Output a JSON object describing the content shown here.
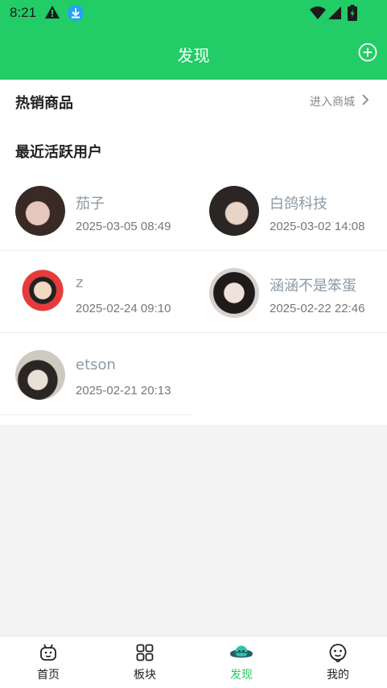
{
  "status_bar": {
    "time": "8:21"
  },
  "app_bar": {
    "title": "发现"
  },
  "shop": {
    "label": "热销商品",
    "enter_label": "进入商城"
  },
  "active_users": {
    "title": "最近活跃用户",
    "users": [
      {
        "name": "茄子",
        "time": "2025-03-05 08:49"
      },
      {
        "name": "白鸽科技",
        "time": "2025-03-02 14:08"
      },
      {
        "name": "z",
        "time": "2025-02-24 09:10"
      },
      {
        "name": "涵涵不是笨蛋",
        "time": "2025-02-22 22:46"
      },
      {
        "name": "etson",
        "time": "2025-02-21 20:13"
      }
    ]
  },
  "tabs": [
    {
      "label": "首页",
      "icon": "home-robot-icon"
    },
    {
      "label": "板块",
      "icon": "grid-icon"
    },
    {
      "label": "发现",
      "icon": "planet-icon",
      "active": true
    },
    {
      "label": "我的",
      "icon": "profile-icon"
    }
  ],
  "colors": {
    "accent": "#22cc66",
    "name_text": "#8e9aa6"
  }
}
